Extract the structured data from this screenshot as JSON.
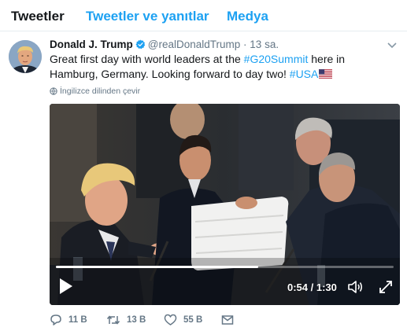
{
  "tabs": [
    {
      "label": "Tweetler",
      "active": true
    },
    {
      "label": "Tweetler ve yanıtlar",
      "active": false
    },
    {
      "label": "Medya",
      "active": false
    }
  ],
  "tweet": {
    "author_name": "Donald J. Trump",
    "handle": "@realDonaldTrump",
    "separator": "·",
    "time": "13 sa.",
    "text_part1": "Great first day with world leaders at the ",
    "hashtag1": "#G20Summit",
    "text_part2": " here in Hamburg, Germany. Looking forward to day two! ",
    "hashtag2": "#USA",
    "translate_label": "İngilizce dilinden çevir"
  },
  "video": {
    "current_time": "0:54",
    "time_sep": " / ",
    "duration": "1:30",
    "progress_fraction": 0.6
  },
  "actions": {
    "reply_count": "11 B",
    "retweet_count": "13 B",
    "like_count": "55 B"
  },
  "colors": {
    "link": "#1da1f2",
    "text": "#14171a",
    "muted": "#657786",
    "border": "#e6ecf0"
  },
  "icons": {
    "verified": "verified-badge-icon",
    "caret": "chevron-down-icon",
    "globe": "globe-icon",
    "flag": "us-flag-icon",
    "play": "play-icon",
    "volume": "volume-icon",
    "fullscreen": "fullscreen-icon",
    "reply": "reply-icon",
    "retweet": "retweet-icon",
    "like": "heart-icon",
    "dm": "envelope-icon"
  }
}
